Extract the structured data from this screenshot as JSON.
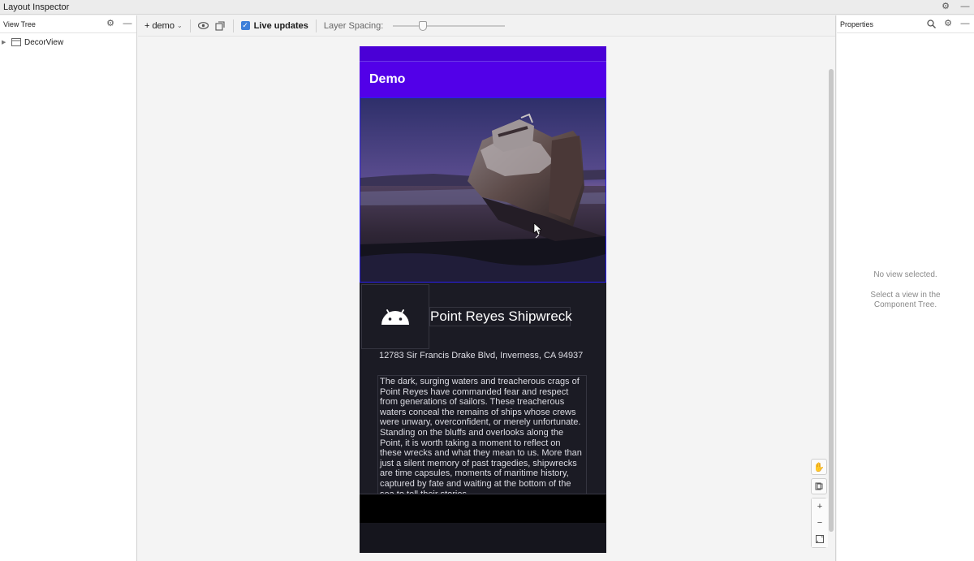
{
  "window": {
    "title": "Layout Inspector"
  },
  "view_tree": {
    "header": "View Tree",
    "items": [
      {
        "label": "DecorView"
      }
    ]
  },
  "toolbar": {
    "process_label": "demo",
    "live_updates_label": "Live updates",
    "live_updates_checked": true,
    "layer_spacing_label": "Layer Spacing:",
    "layer_spacing_value": 0.25
  },
  "device": {
    "app_title": "Demo",
    "place_title": "Point Reyes Shipwreck",
    "address": "12783 Sir Francis Drake Blvd, Inverness, CA 94937",
    "description": "The dark, surging waters and treacherous crags of Point Reyes have commanded fear and respect from generations of sailors. These treacherous waters conceal the remains of ships whose crews were unwary, overconfident, or merely unfortunate. Standing on the bluffs and overlooks along the Point, it is worth taking a moment to reflect on these wrecks and what they mean to us. More than just a silent memory of past tragedies, shipwrecks are time capsules, moments of maritime history, captured by fate and waiting at the bottom of the sea to tell their stories.",
    "colors": {
      "app_bar": "#5200e8",
      "status_bar": "#4a00d6",
      "background": "#1b1b24"
    }
  },
  "properties": {
    "header": "Properties",
    "empty_line1": "No view selected.",
    "empty_line2": "Select a view in the",
    "empty_line3": "Component Tree."
  },
  "icons": {
    "settings": "gear-icon",
    "minimize": "minimize-icon",
    "search": "search-icon",
    "eye": "eye-icon",
    "export": "export-icon",
    "pan": "hand-icon",
    "zoom_in": "plus-icon",
    "zoom_out": "minus-icon",
    "fit": "fit-screen-icon"
  }
}
